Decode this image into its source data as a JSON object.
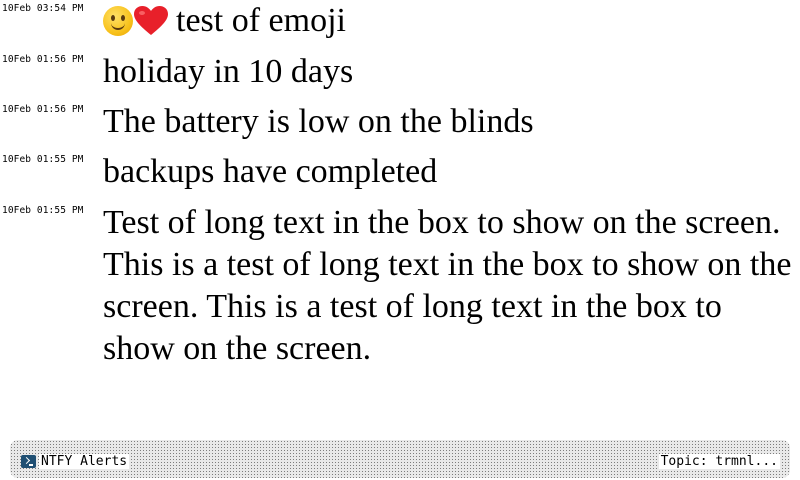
{
  "messages": [
    {
      "timestamp": "10Feb 03:54 PM",
      "text": "test of emoji",
      "emoji": [
        "smiling-face-emoji",
        "red-heart-emoji"
      ]
    },
    {
      "timestamp": "10Feb 01:56 PM",
      "text": "holiday in 10 days"
    },
    {
      "timestamp": "10Feb 01:56 PM",
      "text": "The battery is low on the blinds"
    },
    {
      "timestamp": "10Feb 01:55 PM",
      "text": "backups have completed"
    },
    {
      "timestamp": "10Feb 01:55 PM",
      "text": "Test of long text in the box to show on the screen. This is a test of long text in the box to show on the screen. This is a test of long text in the box to show on the screen."
    }
  ],
  "footer": {
    "app_name": "NTFY Alerts",
    "app_icon": "terminal-icon",
    "topic": "Topic: trmnl..."
  },
  "colors": {
    "heart": "#e8202a",
    "smile": "#f8c21c",
    "app_icon": "#1f4f73"
  }
}
